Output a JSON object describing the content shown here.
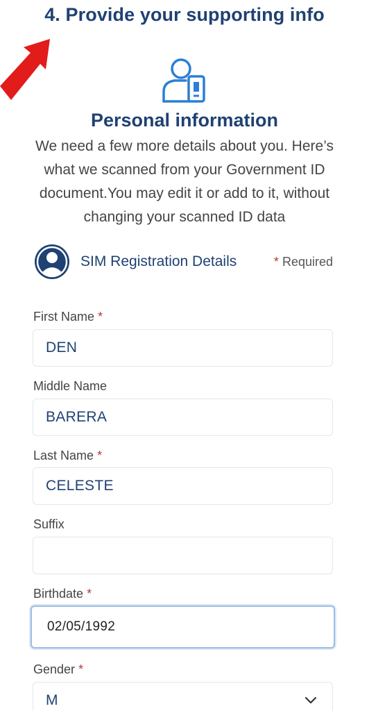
{
  "step": {
    "title": "4. Provide your supporting info"
  },
  "personal": {
    "title": "Personal information",
    "description": "We need a few more details about you. Here’s what we scanned from your Government ID document.You may edit it or add to it, without changing your scanned ID data"
  },
  "details": {
    "label": "SIM Registration Details",
    "required_star": "*",
    "required_text": "Required"
  },
  "form": {
    "first_name": {
      "label": "First Name",
      "star": "*",
      "value": "DEN"
    },
    "middle_name": {
      "label": "Middle Name",
      "value": "BARERA"
    },
    "last_name": {
      "label": "Last Name",
      "star": "*",
      "value": "CELESTE"
    },
    "suffix": {
      "label": "Suffix",
      "value": ""
    },
    "birthdate": {
      "label": "Birthdate",
      "star": "*",
      "value": "02/05/1992"
    },
    "gender": {
      "label": "Gender",
      "star": "*",
      "value": "M"
    }
  },
  "colors": {
    "primary": "#1f4173",
    "accent": "#2b7fd4",
    "required": "#b53a3a",
    "arrow": "#e21b1b"
  },
  "icons": [
    "arrow-icon",
    "person-phone-icon",
    "user-avatar-icon",
    "chevron-down-icon"
  ]
}
